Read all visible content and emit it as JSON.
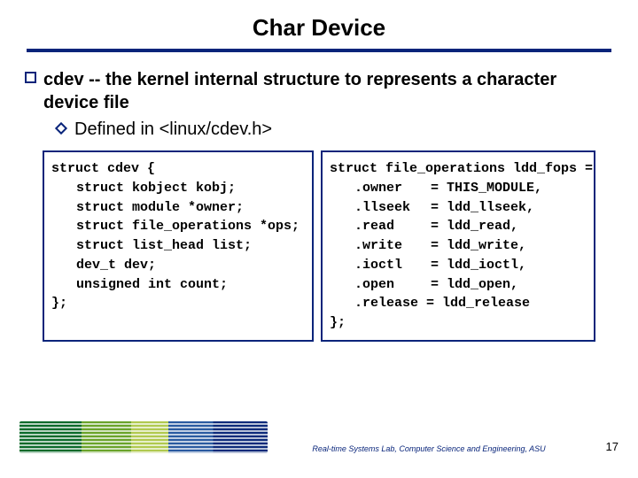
{
  "title": "Char Device",
  "bullet1": "cdev -- the kernel internal structure to represents a character device file",
  "bullet2": "Defined in <linux/cdev.h>",
  "code_left": {
    "l0": "struct cdev {",
    "l1": "struct kobject kobj;",
    "l2": "struct module *owner;",
    "l3": "struct file_operations *ops;",
    "l4": "struct list_head list;",
    "l5": "dev_t dev;",
    "l6": "unsigned int count;",
    "l7": "};"
  },
  "code_right": {
    "l0": "struct file_operations ldd_fops = {",
    "rows": [
      {
        "f": ".owner",
        "v": "= THIS_MODULE,"
      },
      {
        "f": ".llseek",
        "v": "= ldd_llseek,"
      },
      {
        "f": ".read",
        "v": "= ldd_read,"
      },
      {
        "f": ".write",
        "v": "= ldd_write,"
      },
      {
        "f": ".ioctl",
        "v": "= ldd_ioctl,"
      },
      {
        "f": ".open",
        "v": "= ldd_open,"
      },
      {
        "f": ".release",
        "v": "= ldd_release"
      }
    ],
    "l8": "};"
  },
  "footer": "Real-time Systems Lab, Computer Science and Engineering, ASU",
  "pagenum": "17"
}
